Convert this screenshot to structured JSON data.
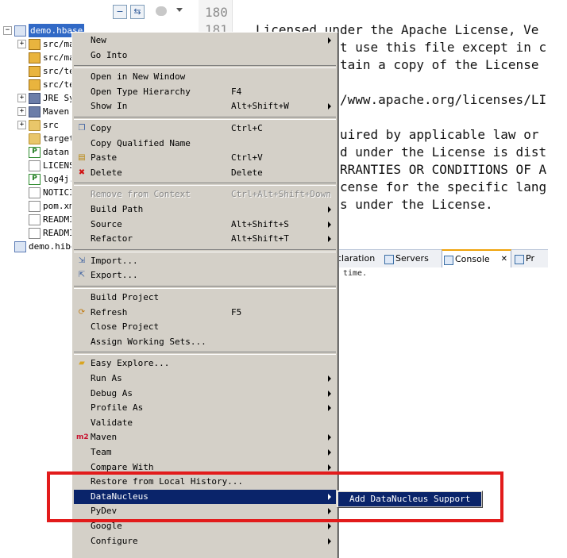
{
  "explorer": {
    "items": [
      {
        "label": "demo.hbase",
        "icon": "maven-project-icon",
        "expand": "−",
        "indent": 0,
        "selected": true
      },
      {
        "label": "src/ma",
        "icon": "package-folder-icon",
        "expand": "+",
        "indent": 1
      },
      {
        "label": "src/ma",
        "icon": "package-folder-icon",
        "expand": "",
        "indent": 1
      },
      {
        "label": "src/te",
        "icon": "package-folder-icon",
        "expand": "",
        "indent": 1
      },
      {
        "label": "src/te",
        "icon": "package-folder-icon",
        "expand": "",
        "indent": 1
      },
      {
        "label": "JRE Sy",
        "icon": "library-icon",
        "expand": "+",
        "indent": 1
      },
      {
        "label": "Maven",
        "icon": "library-icon",
        "expand": "+",
        "indent": 1
      },
      {
        "label": "src",
        "icon": "folder-icon",
        "expand": "+",
        "indent": 1
      },
      {
        "label": "target",
        "icon": "folder-icon",
        "expand": "",
        "indent": 1
      },
      {
        "label": "datan",
        "icon": "properties-file-icon",
        "expand": "",
        "indent": 1
      },
      {
        "label": "LICENS",
        "icon": "text-file-icon",
        "expand": "",
        "indent": 1
      },
      {
        "label": "log4j.",
        "icon": "properties-file-icon",
        "expand": "",
        "indent": 1
      },
      {
        "label": "NOTICI",
        "icon": "text-file-icon",
        "expand": "",
        "indent": 1
      },
      {
        "label": "pom.xm",
        "icon": "xml-file-icon",
        "expand": "",
        "indent": 1
      },
      {
        "label": "READMI",
        "icon": "text-file-icon",
        "expand": "",
        "indent": 1
      },
      {
        "label": "READMI",
        "icon": "text-file-icon",
        "expand": "",
        "indent": 1
      },
      {
        "label": "demo.hibe",
        "icon": "project-icon",
        "expand": "",
        "indent": 0
      }
    ]
  },
  "editor": {
    "line_numbers": [
      "180",
      "181"
    ],
    "lines": [
      "Licensed under the Apache License, Ve",
      "t use this file except in c",
      "tain a copy of the License",
      "/www.apache.org/licenses/LI",
      "uired by applicable law or",
      "d under the License is dist",
      "RRANTIES OR CONDITIONS OF A",
      "cense for the specific lang",
      "s under the License."
    ]
  },
  "views": {
    "tabs": [
      {
        "label": "claration",
        "active": false
      },
      {
        "label": "Servers",
        "active": false,
        "icon": "servers-icon"
      },
      {
        "label": "Console",
        "active": true,
        "icon": "console-icon",
        "close": "✕"
      },
      {
        "label": "Pr",
        "active": false,
        "icon": "progress-icon"
      }
    ],
    "console_text": "time."
  },
  "context_menu": {
    "items": [
      {
        "type": "item",
        "label": "New",
        "submenu": true
      },
      {
        "type": "item",
        "label": "Go Into"
      },
      {
        "type": "sep"
      },
      {
        "type": "item",
        "label": "Open in New Window"
      },
      {
        "type": "item",
        "label": "Open Type Hierarchy",
        "shortcut": "F4"
      },
      {
        "type": "item",
        "label": "Show In",
        "shortcut": "Alt+Shift+W",
        "submenu": true
      },
      {
        "type": "sep"
      },
      {
        "type": "item",
        "label": "Copy",
        "shortcut": "Ctrl+C",
        "icon": "copy-icon"
      },
      {
        "type": "item",
        "label": "Copy Qualified Name"
      },
      {
        "type": "item",
        "label": "Paste",
        "shortcut": "Ctrl+V",
        "icon": "paste-icon"
      },
      {
        "type": "item",
        "label": "Delete",
        "shortcut": "Delete",
        "icon": "delete-icon"
      },
      {
        "type": "sep"
      },
      {
        "type": "item",
        "label": "Remove from Context",
        "shortcut": "Ctrl+Alt+Shift+Down",
        "disabled": true
      },
      {
        "type": "item",
        "label": "Build Path",
        "submenu": true
      },
      {
        "type": "item",
        "label": "Source",
        "shortcut": "Alt+Shift+S",
        "submenu": true
      },
      {
        "type": "item",
        "label": "Refactor",
        "shortcut": "Alt+Shift+T",
        "submenu": true
      },
      {
        "type": "sep"
      },
      {
        "type": "item",
        "label": "Import...",
        "icon": "import-icon"
      },
      {
        "type": "item",
        "label": "Export...",
        "icon": "export-icon"
      },
      {
        "type": "sep"
      },
      {
        "type": "item",
        "label": "Build Project"
      },
      {
        "type": "item",
        "label": "Refresh",
        "shortcut": "F5",
        "icon": "refresh-icon"
      },
      {
        "type": "item",
        "label": "Close Project"
      },
      {
        "type": "item",
        "label": "Assign Working Sets..."
      },
      {
        "type": "sep"
      },
      {
        "type": "item",
        "label": "Easy Explore...",
        "icon": "folder-open-icon"
      },
      {
        "type": "item",
        "label": "Run As",
        "submenu": true
      },
      {
        "type": "item",
        "label": "Debug As",
        "submenu": true
      },
      {
        "type": "item",
        "label": "Profile As",
        "submenu": true
      },
      {
        "type": "item",
        "label": "Validate"
      },
      {
        "type": "item",
        "label": "Maven",
        "submenu": true,
        "icon": "maven-m2-icon",
        "icon_text": "m2"
      },
      {
        "type": "item",
        "label": "Team",
        "submenu": true
      },
      {
        "type": "item",
        "label": "Compare With",
        "submenu": true
      },
      {
        "type": "item",
        "label": "Restore from Local History..."
      },
      {
        "type": "item",
        "label": "DataNucleus",
        "submenu": true,
        "highlighted": true
      },
      {
        "type": "item",
        "label": "PyDev",
        "submenu": true
      },
      {
        "type": "item",
        "label": "Google",
        "submenu": true
      },
      {
        "type": "item",
        "label": "Configure",
        "submenu": true
      }
    ]
  },
  "submenu": {
    "items": [
      {
        "label": "Add DataNucleus Support",
        "highlighted": true
      }
    ]
  },
  "colors": {
    "menu_bg": "#d4d0c8",
    "highlight": "#0a246a",
    "annotation": "#e21b1b",
    "selection": "#3169c6"
  }
}
